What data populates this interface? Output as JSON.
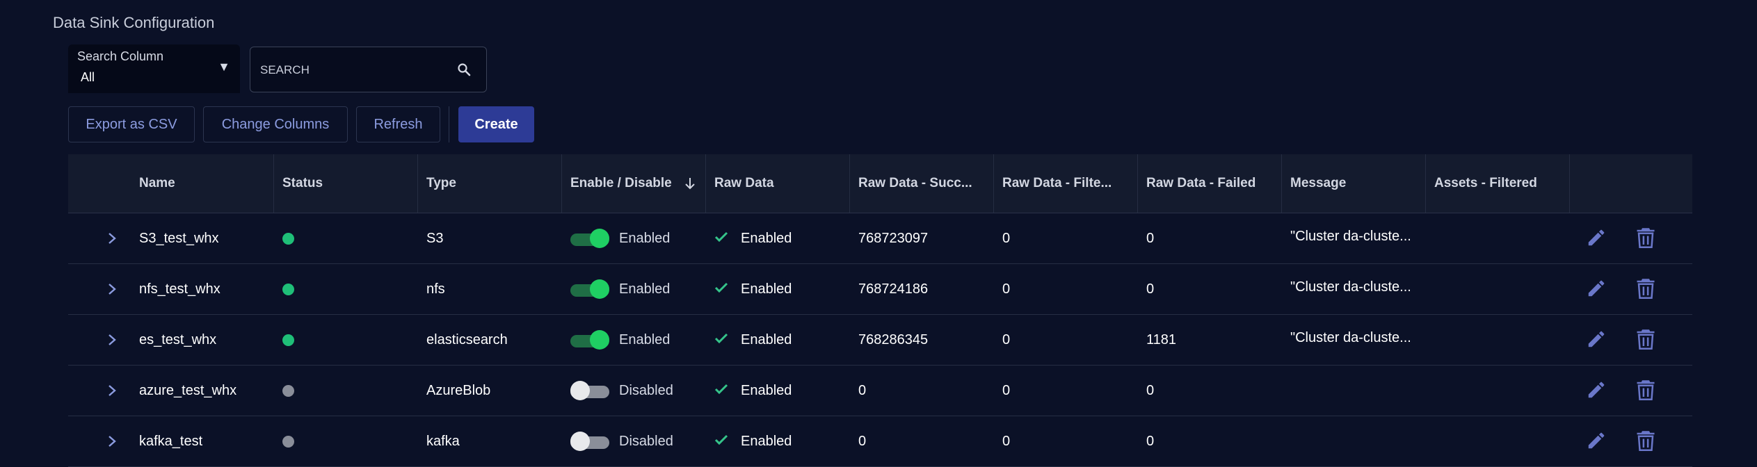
{
  "page": {
    "title": "Data Sink Configuration"
  },
  "search": {
    "column_label": "Search Column",
    "column_value": "All",
    "placeholder": "SEARCH"
  },
  "toolbar": {
    "export_label": "Export as CSV",
    "columns_label": "Change Columns",
    "refresh_label": "Refresh",
    "create_label": "Create"
  },
  "colors": {
    "background": "#0b1127",
    "accent": "#2d3b96",
    "status_active": "#1fbf78",
    "status_inactive": "#8a8e99",
    "toggle_on": "#1fcf63",
    "check": "#35c48a",
    "action_icon": "#6a77c9"
  },
  "table": {
    "columns": [
      "Name",
      "Status",
      "Type",
      "Enable / Disable",
      "Raw Data",
      "Raw Data - Succ...",
      "Raw Data - Filte...",
      "Raw Data - Failed",
      "Message",
      "Assets - Filtered"
    ],
    "sorted_column": "Enable / Disable",
    "rows": [
      {
        "name": "S3_test_whx",
        "status": "active",
        "type": "S3",
        "enabled": true,
        "toggle_label": "Enabled",
        "raw_data": "Enabled",
        "succ": "768723097",
        "filtered": "0",
        "failed": "0",
        "message": "\"Cluster da-cluste...",
        "assets_filtered": ""
      },
      {
        "name": "nfs_test_whx",
        "status": "active",
        "type": "nfs",
        "enabled": true,
        "toggle_label": "Enabled",
        "raw_data": "Enabled",
        "succ": "768724186",
        "filtered": "0",
        "failed": "0",
        "message": "\"Cluster da-cluste...",
        "assets_filtered": ""
      },
      {
        "name": "es_test_whx",
        "status": "active",
        "type": "elasticsearch",
        "enabled": true,
        "toggle_label": "Enabled",
        "raw_data": "Enabled",
        "succ": "768286345",
        "filtered": "0",
        "failed": "1181",
        "message": "\"Cluster da-cluste...",
        "assets_filtered": ""
      },
      {
        "name": "azure_test_whx",
        "status": "inactive",
        "type": "AzureBlob",
        "enabled": false,
        "toggle_label": "Disabled",
        "raw_data": "Enabled",
        "succ": "0",
        "filtered": "0",
        "failed": "0",
        "message": "",
        "assets_filtered": ""
      },
      {
        "name": "kafka_test",
        "status": "inactive",
        "type": "kafka",
        "enabled": false,
        "toggle_label": "Disabled",
        "raw_data": "Enabled",
        "succ": "0",
        "filtered": "0",
        "failed": "0",
        "message": "",
        "assets_filtered": ""
      }
    ]
  },
  "icons": {
    "search": "search-icon",
    "sort": "arrow-down-icon",
    "expand": "chevron-right-icon",
    "check": "check-icon",
    "edit": "pencil-icon",
    "delete": "trash-icon",
    "dropdown": "caret-down-icon"
  }
}
